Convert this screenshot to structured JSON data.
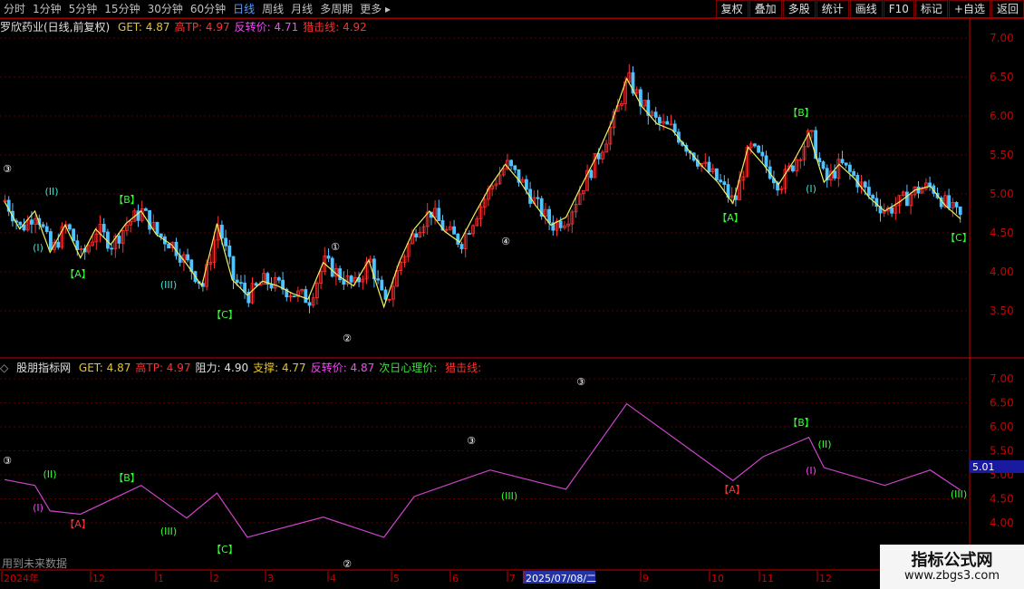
{
  "toolbar": {
    "left": [
      "分时",
      "1分钟",
      "5分钟",
      "15分钟",
      "30分钟",
      "60分钟",
      "日线",
      "周线",
      "月线",
      "多周期",
      "更多"
    ],
    "selected": "日线",
    "right": [
      "复权",
      "叠加",
      "多股",
      "统计",
      "画线",
      "F10",
      "标记",
      "+自选",
      "返回"
    ]
  },
  "main_header": {
    "title": "罗欣药业(日线,前复权)",
    "items": [
      {
        "label": "GET:",
        "value": "4.87",
        "color": "#e6c229"
      },
      {
        "label": "高TP:",
        "value": "4.97",
        "color": "#ff3030"
      },
      {
        "label": "反转价:",
        "value": "4.71",
        "color": "#ff44ff"
      },
      {
        "label": "猎击线:",
        "value": "4.92",
        "color": "#ff3030"
      }
    ]
  },
  "sub_header": {
    "title": "股朋指标网",
    "items": [
      {
        "label": "GET:",
        "value": "4.87",
        "color": "#e6c229"
      },
      {
        "label": "高TP:",
        "value": "4.97",
        "color": "#ff3030"
      },
      {
        "label": "阻力:",
        "value": "4.90",
        "color": "#e0e0e0"
      },
      {
        "label": "支撑:",
        "value": "4.77",
        "color": "#e6c229"
      },
      {
        "label": "反转价:",
        "value": "4.87",
        "color": "#ff44ff"
      },
      {
        "label": "次日心理价:",
        "value": "",
        "color": "#44dd44"
      },
      {
        "label": "猎击线:",
        "value": "",
        "color": "#ff3030"
      }
    ]
  },
  "main_axis_ticks": [
    "7.00",
    "6.50",
    "6.00",
    "5.50",
    "5.00",
    "4.50",
    "4.00",
    "3.50"
  ],
  "sub_axis_ticks": [
    "7.00",
    "6.50",
    "6.00",
    "5.50",
    "5.00",
    "4.50",
    "4.00"
  ],
  "price_tag": "5.01",
  "x_labels": [
    "2024年",
    "12",
    "1",
    "2",
    "3",
    "4",
    "5",
    "6",
    "7",
    "2025/07/08/二",
    "9",
    "10",
    "11",
    "12"
  ],
  "footer_text": "用到未来数据",
  "watermark": {
    "line1": "指标公式网",
    "line2": "www.zbgs3.com"
  },
  "wave_labels_main": [
    {
      "t": "③",
      "c": "#ffffff"
    },
    {
      "t": "(I)",
      "c": "#40e0d0"
    },
    {
      "t": "(II)",
      "c": "#40e0d0"
    },
    {
      "t": "【A】",
      "c": "#33ff33"
    },
    {
      "t": "【B】",
      "c": "#33ff33"
    },
    {
      "t": "(III)",
      "c": "#40e0d0"
    },
    {
      "t": "【C】",
      "c": "#33ff33"
    },
    {
      "t": "①",
      "c": "#ffffff"
    },
    {
      "t": "②",
      "c": "#ffffff"
    },
    {
      "t": "④",
      "c": "#ffffff"
    },
    {
      "t": "【A】",
      "c": "#33ff33"
    },
    {
      "t": "【B】",
      "c": "#33ff33"
    },
    {
      "t": "(I)",
      "c": "#40e0d0"
    },
    {
      "t": "【C】",
      "c": "#33ff33"
    }
  ],
  "colors": {
    "up": "#ff3030",
    "down": "#4fc3ff",
    "grid": "#5a0000",
    "zigzag": "#f0f060",
    "sub_line": "#cc44cc",
    "axis": "#cc0000"
  },
  "chart_data": {
    "type": "line",
    "main_close_path": [
      4.9,
      4.55,
      4.78,
      4.25,
      4.6,
      4.18,
      4.55,
      4.35,
      4.62,
      4.78,
      4.48,
      4.35,
      4.1,
      3.82,
      4.62,
      3.9,
      3.7,
      3.88,
      3.82,
      3.72,
      3.65,
      4.12,
      3.95,
      3.82,
      4.15,
      3.55,
      4.12,
      4.55,
      4.78,
      4.52,
      4.38,
      4.75,
      5.1,
      5.38,
      5.15,
      4.85,
      4.6,
      4.7,
      5.1,
      5.48,
      5.92,
      6.48,
      6.12,
      5.9,
      5.82,
      5.58,
      5.35,
      5.15,
      4.88,
      5.6,
      5.38,
      5.12,
      5.42,
      5.78,
      5.15,
      5.38,
      5.2,
      4.95,
      4.78,
      4.9,
      5.05,
      5.1,
      4.85,
      4.68
    ],
    "y_range_main": [
      3.0,
      7.2
    ],
    "y_range_sub": [
      3.6,
      7.2
    ]
  }
}
